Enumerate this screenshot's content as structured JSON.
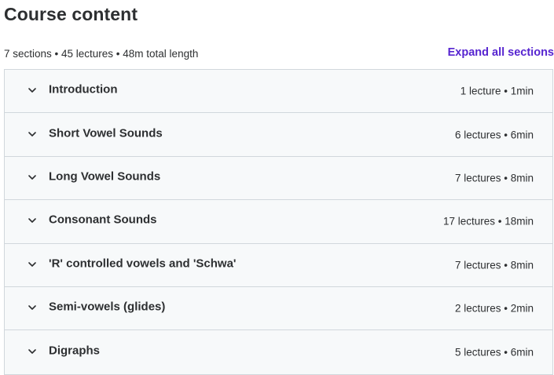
{
  "header": {
    "title": "Course content",
    "summary": "7 sections • 45 lectures • 48m total length",
    "expand_label": "Expand all sections"
  },
  "sections": [
    {
      "title": "Introduction",
      "meta": "1 lecture • 1min"
    },
    {
      "title": "Short Vowel Sounds",
      "meta": "6 lectures • 6min"
    },
    {
      "title": "Long Vowel Sounds",
      "meta": "7 lectures • 8min"
    },
    {
      "title": "Consonant Sounds",
      "meta": "17 lectures • 18min"
    },
    {
      "title": "'R' controlled vowels and 'Schwa'",
      "meta": "7 lectures • 8min"
    },
    {
      "title": "Semi-vowels (glides)",
      "meta": "2 lectures • 2min"
    },
    {
      "title": "Digraphs",
      "meta": "5 lectures • 6min"
    }
  ],
  "icons": {
    "section_toggle": "chevron-down-icon"
  },
  "colors": {
    "accent": "#5624d0",
    "text": "#2d2f31",
    "section_bg": "#f7f9fa",
    "border": "#d1d7dc"
  }
}
